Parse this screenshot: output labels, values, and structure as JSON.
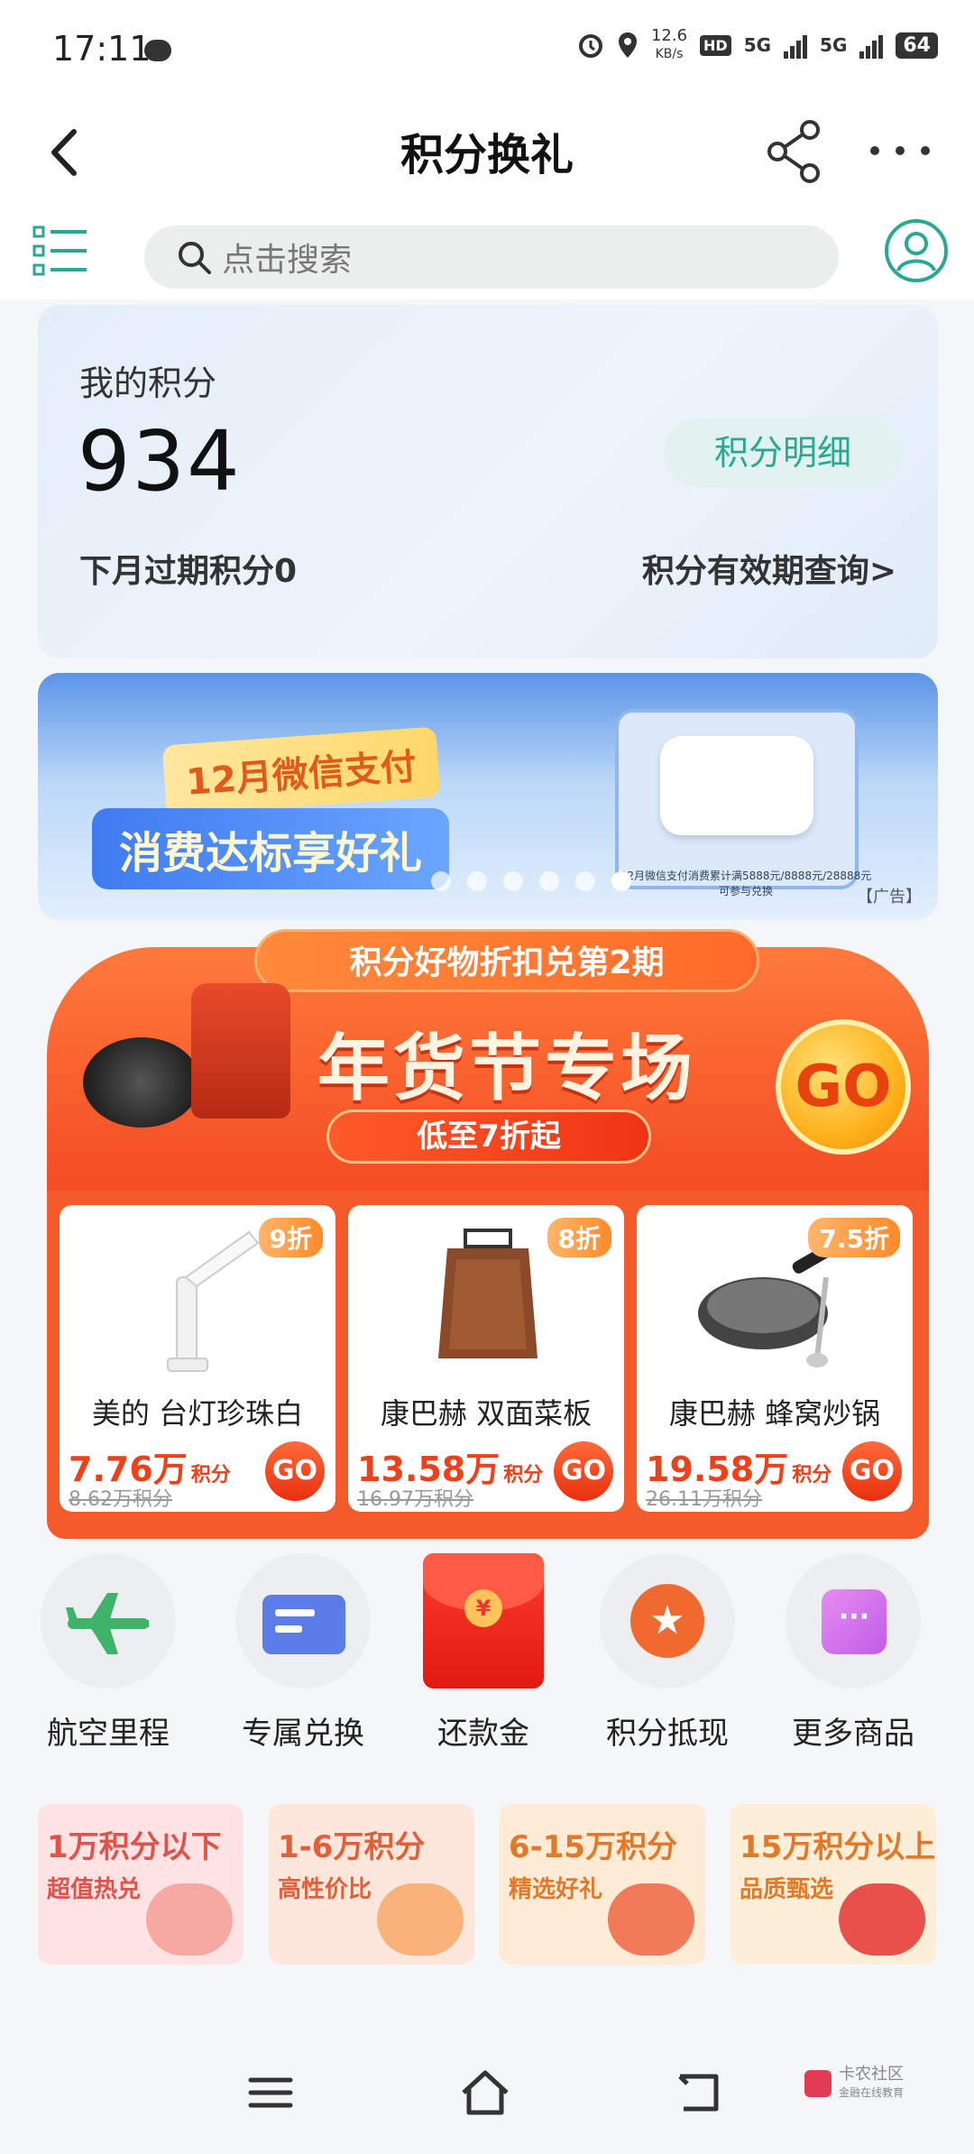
{
  "status": {
    "time": "17:11",
    "speed_value": "12.6",
    "speed_unit": "KB/s",
    "hd": "HD",
    "net1": "5G",
    "net2": "5G",
    "battery": "64"
  },
  "nav": {
    "title": "积分换礼"
  },
  "search": {
    "placeholder": "点击搜索"
  },
  "points": {
    "label": "我的积分",
    "value": "934",
    "detail_button": "积分明细",
    "expire_text": "下月过期积分0",
    "validity_link": "积分有效期查询>"
  },
  "banner": {
    "tag1": "12月微信支付",
    "tag2": "消费达标享好礼",
    "caption": "12月微信支付消费累计满5888元/8888元/28888元可参与兑换",
    "ad_label": "【广告】",
    "dot_count": 6,
    "active_dot": 5
  },
  "promo": {
    "topbar": "积分好物折扣兑第2期",
    "title": "年货节专场",
    "subtitle": "低至7折起",
    "go": "GO",
    "products": [
      {
        "name": "美的 台灯珍珠白",
        "badge": "9折",
        "price": "7.76万",
        "unit": "积分",
        "original": "8.62万积分",
        "go": "GO"
      },
      {
        "name": "康巴赫 双面菜板",
        "badge": "8折",
        "price": "13.58万",
        "unit": "积分",
        "original": "16.97万积分",
        "go": "GO"
      },
      {
        "name": "康巴赫 蜂窝炒锅",
        "badge": "7.5折",
        "price": "19.58万",
        "unit": "积分",
        "original": "26.11万积分",
        "go": "GO"
      }
    ]
  },
  "quick": [
    {
      "label": "航空里程",
      "icon": "airplane-icon"
    },
    {
      "label": "专属兑换",
      "icon": "card-icon"
    },
    {
      "label": "还款金",
      "icon": "red-envelope-icon",
      "coin": "¥"
    },
    {
      "label": "积分抵现",
      "icon": "star-icon",
      "glyph": "★"
    },
    {
      "label": "更多商品",
      "icon": "more-icon",
      "glyph": "···"
    }
  ],
  "tiers": [
    {
      "title": "1万积分以下",
      "sub": "超值热兑",
      "color": "#e0524a",
      "bg": "#fde3e3"
    },
    {
      "title": "1-6万积分",
      "sub": "高性价比",
      "color": "#e0603a",
      "bg": "#fde6dc"
    },
    {
      "title": "6-15万积分",
      "sub": "精选好礼",
      "color": "#e07a2a",
      "bg": "#fdebd6"
    },
    {
      "title": "15万积分以上",
      "sub": "品质甄选",
      "color": "#e07a2a",
      "bg": "#fdeed8"
    }
  ],
  "brand": {
    "name": "卡农社区",
    "tagline": "金融在线教育"
  },
  "colors": {
    "accent": "#2aa795",
    "promo_red": "#f34a22",
    "price_red": "#f0401a"
  }
}
